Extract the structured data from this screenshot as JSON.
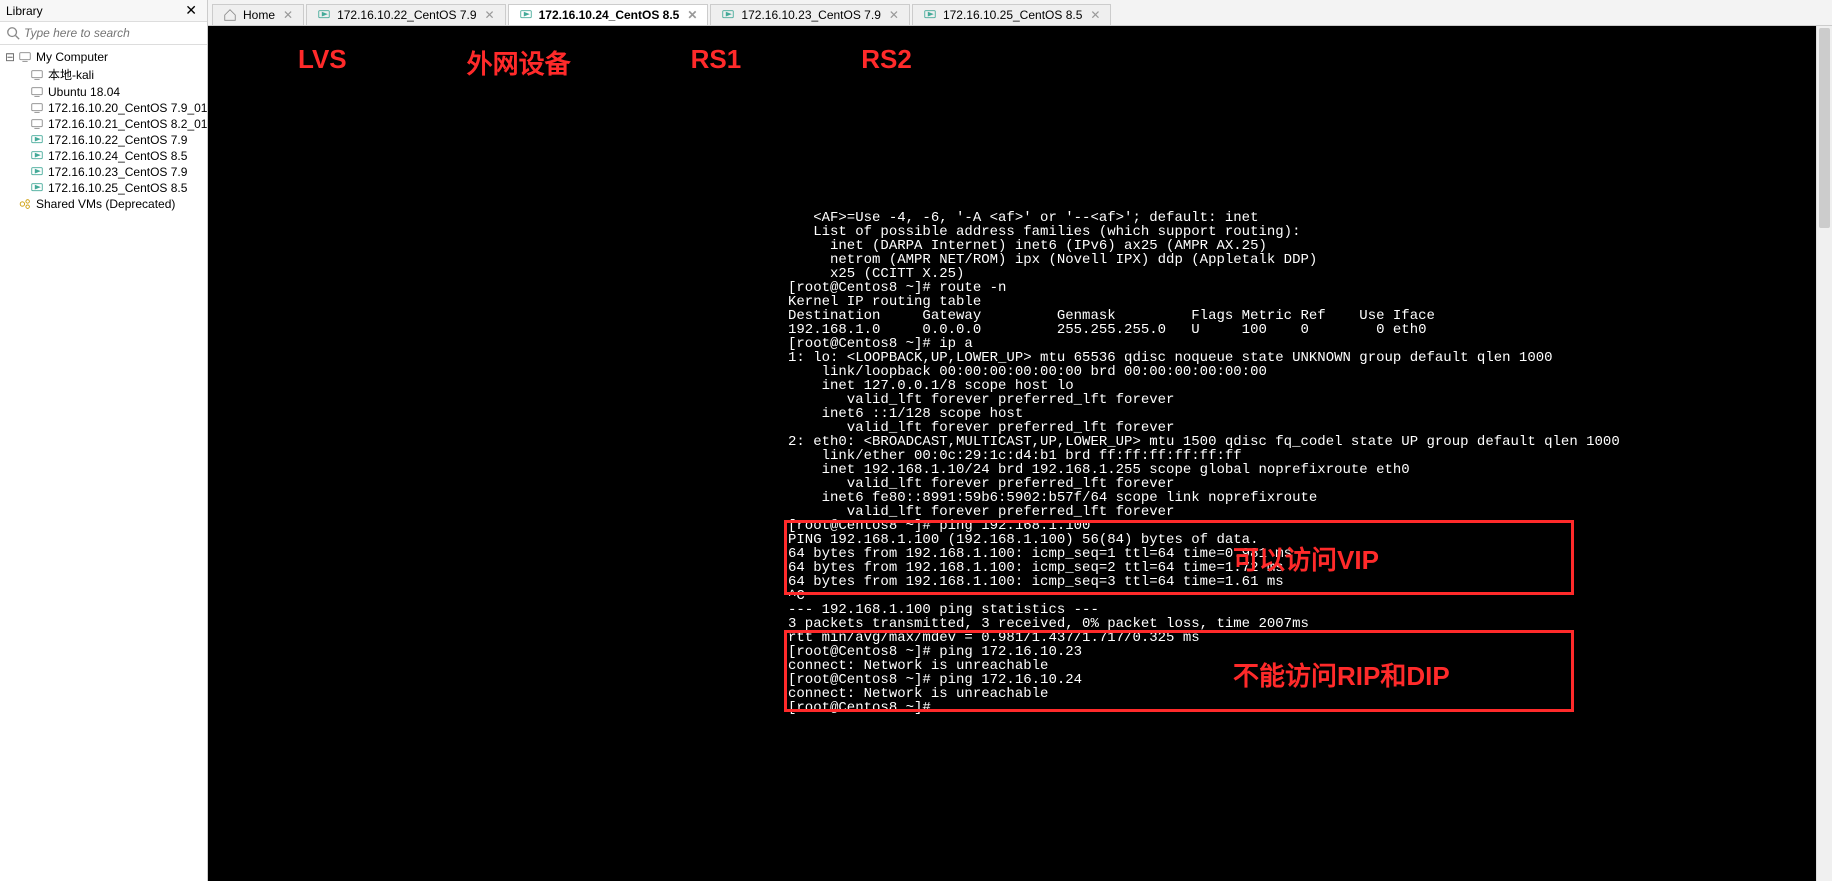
{
  "sidebar": {
    "title": "Library",
    "search_placeholder": "Type here to search",
    "root": "My Computer",
    "items": [
      {
        "label": "本地-kali"
      },
      {
        "label": "Ubuntu 18.04"
      },
      {
        "label": "172.16.10.20_CentOS 7.9_01_Snap"
      },
      {
        "label": "172.16.10.21_CentOS 8.2_01_Snap"
      },
      {
        "label": "172.16.10.22_CentOS 7.9"
      },
      {
        "label": "172.16.10.24_CentOS 8.5"
      },
      {
        "label": "172.16.10.23_CentOS 7.9"
      },
      {
        "label": "172.16.10.25_CentOS 8.5"
      }
    ],
    "shared": "Shared VMs (Deprecated)"
  },
  "tabs": {
    "home": "Home",
    "items": [
      {
        "label": "172.16.10.22_CentOS 7.9"
      },
      {
        "label": "172.16.10.24_CentOS 8.5"
      },
      {
        "label": "172.16.10.23_CentOS 7.9"
      },
      {
        "label": "172.16.10.25_CentOS 8.5"
      }
    ],
    "active_index": 1
  },
  "labels": {
    "l1": "LVS",
    "l2": "外网设备",
    "l3": "RS1",
    "l4": "RS2"
  },
  "annotations": {
    "a1": "可以访问VIP",
    "a2": "不能访问RIP和DIP"
  },
  "terminal": "   <AF>=Use -4, -6, '-A <af>' or '--<af>'; default: inet\n   List of possible address families (which support routing):\n     inet (DARPA Internet) inet6 (IPv6) ax25 (AMPR AX.25)\n     netrom (AMPR NET/ROM) ipx (Novell IPX) ddp (Appletalk DDP)\n     x25 (CCITT X.25)\n[root@Centos8 ~]# route -n\nKernel IP routing table\nDestination     Gateway         Genmask         Flags Metric Ref    Use Iface\n192.168.1.0     0.0.0.0         255.255.255.0   U     100    0        0 eth0\n[root@Centos8 ~]# ip a\n1: lo: <LOOPBACK,UP,LOWER_UP> mtu 65536 qdisc noqueue state UNKNOWN group default qlen 1000\n    link/loopback 00:00:00:00:00:00 brd 00:00:00:00:00:00\n    inet 127.0.0.1/8 scope host lo\n       valid_lft forever preferred_lft forever\n    inet6 ::1/128 scope host\n       valid_lft forever preferred_lft forever\n2: eth0: <BROADCAST,MULTICAST,UP,LOWER_UP> mtu 1500 qdisc fq_codel state UP group default qlen 1000\n    link/ether 00:0c:29:1c:d4:b1 brd ff:ff:ff:ff:ff:ff\n    inet 192.168.1.10/24 brd 192.168.1.255 scope global noprefixroute eth0\n       valid_lft forever preferred_lft forever\n    inet6 fe80::8991:59b6:5902:b57f/64 scope link noprefixroute\n       valid_lft forever preferred_lft forever\n[root@Centos8 ~]# ping 192.168.1.100\nPING 192.168.1.100 (192.168.1.100) 56(84) bytes of data.\n64 bytes from 192.168.1.100: icmp_seq=1 ttl=64 time=0.981 ms\n64 bytes from 192.168.1.100: icmp_seq=2 ttl=64 time=1.72 ms\n64 bytes from 192.168.1.100: icmp_seq=3 ttl=64 time=1.61 ms\n^C\n--- 192.168.1.100 ping statistics ---\n3 packets transmitted, 3 received, 0% packet loss, time 2007ms\nrtt min/avg/max/mdev = 0.981/1.437/1.717/0.325 ms\n[root@Centos8 ~]# ping 172.16.10.23\nconnect: Network is unreachable\n[root@Centos8 ~]# ping 172.16.10.24\nconnect: Network is unreachable\n[root@Centos8 ~]# "
}
